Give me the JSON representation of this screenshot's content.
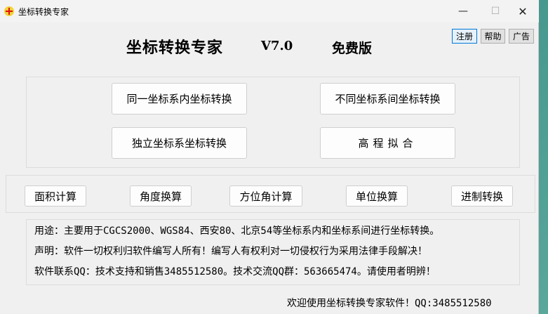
{
  "window": {
    "title": "坐标转换专家"
  },
  "header": {
    "heading": "坐标转换专家",
    "version": "V7.0",
    "edition": "免费版",
    "register_label": "注册",
    "help_label": "帮助",
    "ad_label": "广告"
  },
  "conversions": {
    "same_system": "同一坐标系内坐标转换",
    "between_systems": "不同坐标系间坐标转换",
    "independent": "独立坐标系坐标转换",
    "elevation_fit": "高程拟合"
  },
  "tools": {
    "area": "面积计算",
    "angle": "角度换算",
    "azimuth": "方位角计算",
    "unit": "单位换算",
    "base": "进制转换"
  },
  "info": {
    "purpose": "用途：主要用于CGCS2000、WGS84、西安80、北京54等坐标系内和坐标系间进行坐标转换。",
    "statement": "声明：软件一切权利归软件编写人所有！编写人有权利对一切侵权行为采用法律手段解决！",
    "contact": "软件联系QQ：技术支持和销售3485512580。技术交流QQ群：563665474。请使用者明辨！"
  },
  "footer": {
    "welcome": "欢迎使用坐标转换专家软件！QQ:3485512580"
  },
  "window_controls": {
    "minimize": "—",
    "maximize": "☐",
    "close": "✕"
  }
}
